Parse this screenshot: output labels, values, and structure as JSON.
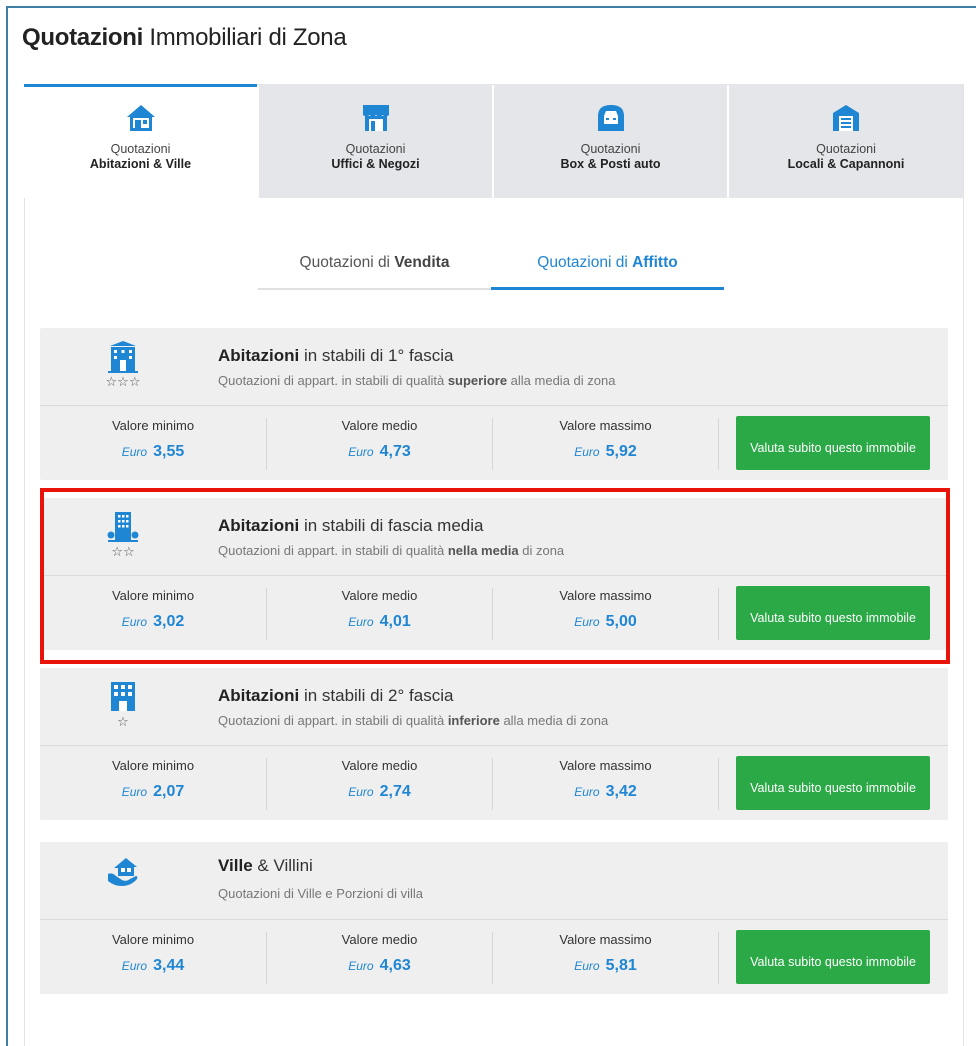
{
  "title": {
    "bold": "Quotazioni",
    "rest": " Immobiliari di Zona"
  },
  "category_tabs": [
    {
      "top": "Quotazioni",
      "bottom": "Abitazioni & Ville",
      "icon": "house-icon",
      "active": true
    },
    {
      "top": "Quotazioni",
      "bottom": "Uffici & Negozi",
      "icon": "shop-icon",
      "active": false
    },
    {
      "top": "Quotazioni",
      "bottom": "Box & Posti auto",
      "icon": "garage-car-icon",
      "active": false
    },
    {
      "top": "Quotazioni",
      "bottom": "Locali & Capannoni",
      "icon": "warehouse-icon",
      "active": false
    }
  ],
  "sub_tabs": [
    {
      "prefix": "Quotazioni di ",
      "bold": "Vendita",
      "active": false
    },
    {
      "prefix": "Quotazioni di ",
      "bold": "Affitto",
      "active": true
    }
  ],
  "labels": {
    "min": "Valore minimo",
    "avg": "Valore medio",
    "max": "Valore massimo",
    "currency": "Euro",
    "cta": "Valuta subito questo immobile"
  },
  "cards": [
    {
      "title_bold": "Abitazioni",
      "title_rest": " in stabili di 1° fascia",
      "sub_pre": "Quotazioni di appart. in stabili di qualità ",
      "sub_bold": "superiore",
      "sub_post": " alla media di zona",
      "stars": "☆☆☆",
      "icon": "building-1st-class-icon",
      "min": "3,55",
      "avg": "4,73",
      "max": "5,92"
    },
    {
      "title_bold": "Abitazioni",
      "title_rest": " in stabili di fascia media",
      "sub_pre": "Quotazioni di appart. in stabili di qualità ",
      "sub_bold": "nella media",
      "sub_post": " di zona",
      "stars": "☆☆",
      "icon": "building-medium-class-icon",
      "min": "3,02",
      "avg": "4,01",
      "max": "5,00"
    },
    {
      "title_bold": "Abitazioni",
      "title_rest": " in stabili di 2° fascia",
      "sub_pre": "Quotazioni di appart. in stabili di qualità ",
      "sub_bold": "inferiore",
      "sub_post": " alla media di zona",
      "stars": "☆",
      "icon": "building-2nd-class-icon",
      "min": "2,07",
      "avg": "2,74",
      "max": "3,42"
    },
    {
      "title_bold": "Ville",
      "title_rest": " & Villini",
      "sub_pre": "Quotazioni di Ville e Porzioni di villa",
      "sub_bold": "",
      "sub_post": "",
      "stars": "",
      "icon": "villa-hand-icon",
      "min": "3,44",
      "avg": "4,63",
      "max": "5,81"
    }
  ],
  "colors": {
    "accent": "#1f86d3",
    "cta": "#2aa946",
    "highlight": "#e8140c",
    "frame": "#3f7fa6"
  }
}
